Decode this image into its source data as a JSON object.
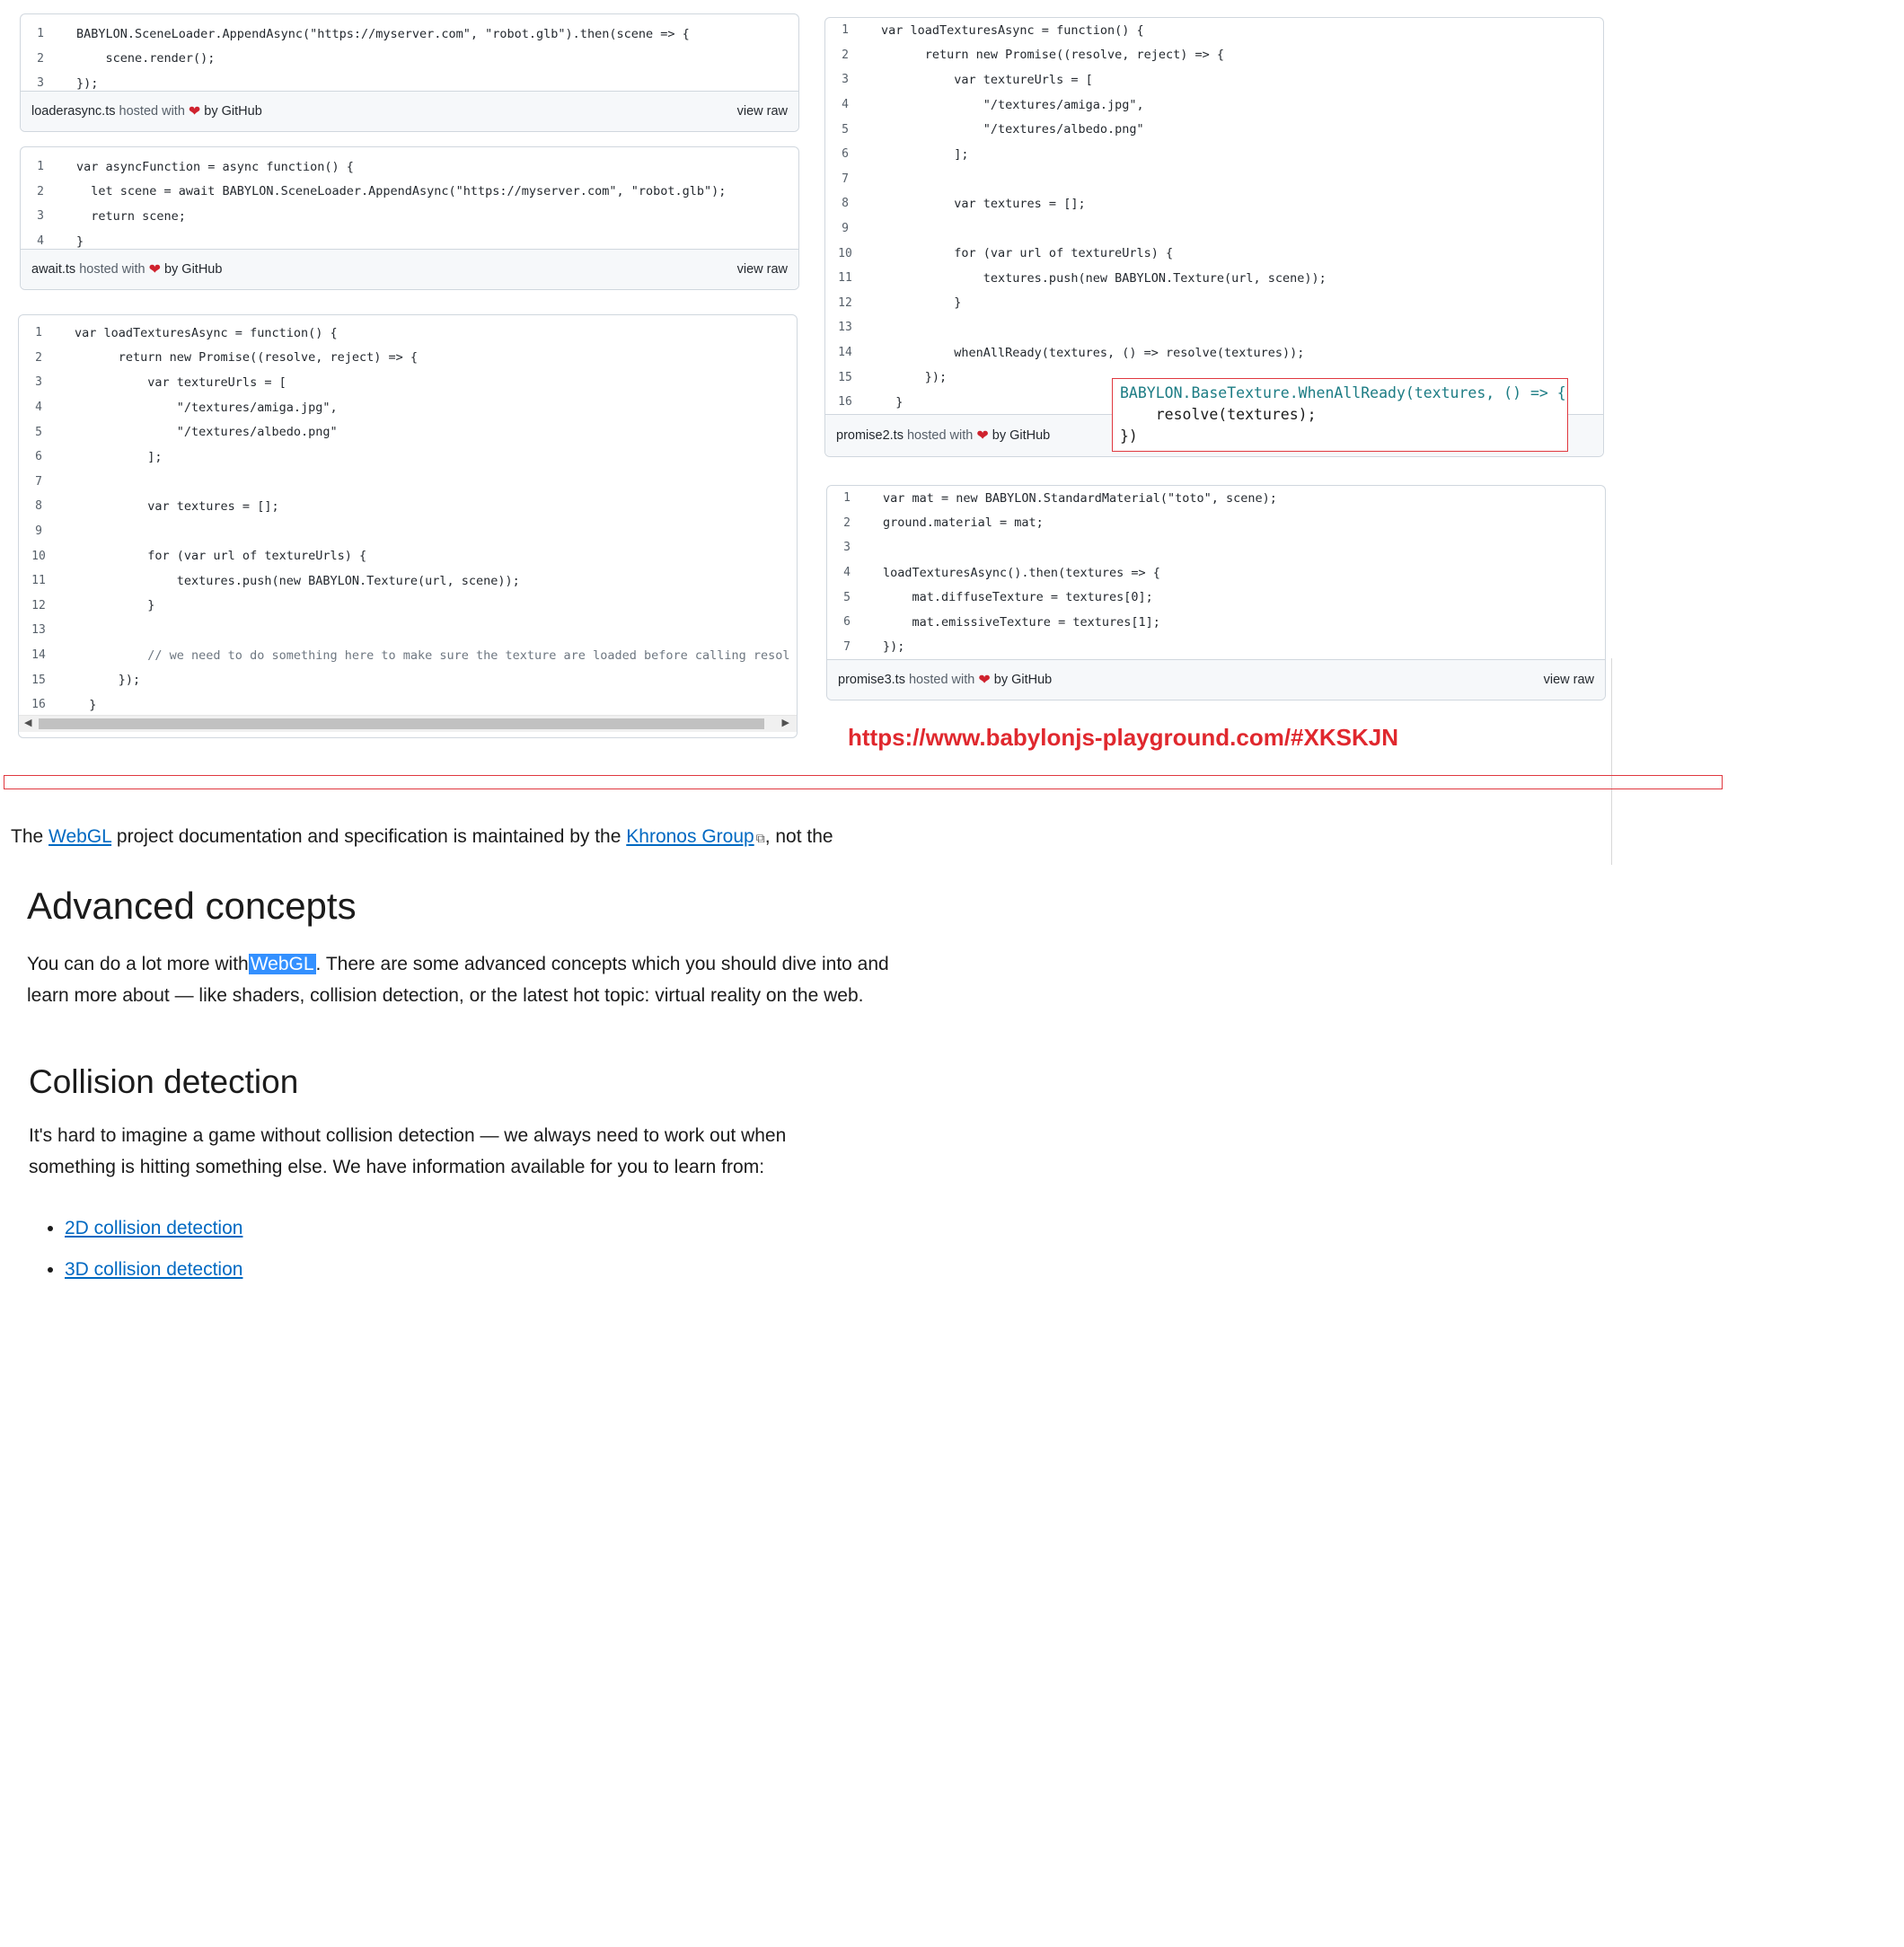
{
  "gist_loaderasync": {
    "lines": [
      {
        "n": "1",
        "t": "BABYLON.SceneLoader.AppendAsync(\"https://myserver.com\", \"robot.glb\").then(scene => {"
      },
      {
        "n": "2",
        "t": "    scene.render();"
      },
      {
        "n": "3",
        "t": "});"
      }
    ],
    "filename": "loaderasync.ts",
    "hosted": "hosted with",
    "by": "by GitHub",
    "raw": "view raw"
  },
  "gist_await": {
    "lines": [
      {
        "n": "1",
        "t": "var asyncFunction = async function() {"
      },
      {
        "n": "2",
        "t": "  let scene = await BABYLON.SceneLoader.AppendAsync(\"https://myserver.com\", \"robot.glb\");"
      },
      {
        "n": "3",
        "t": "  return scene;"
      },
      {
        "n": "4",
        "t": "}"
      }
    ],
    "filename": "await.ts",
    "hosted": "hosted with",
    "by": "by GitHub",
    "raw": "view raw"
  },
  "gist_promise1": {
    "lines": [
      {
        "n": "1",
        "t": "var loadTexturesAsync = function() {"
      },
      {
        "n": "2",
        "t": "      return new Promise((resolve, reject) => {"
      },
      {
        "n": "3",
        "t": "          var textureUrls = ["
      },
      {
        "n": "4",
        "t": "              \"/textures/amiga.jpg\","
      },
      {
        "n": "5",
        "t": "              \"/textures/albedo.png\""
      },
      {
        "n": "6",
        "t": "          ];"
      },
      {
        "n": "7",
        "t": ""
      },
      {
        "n": "8",
        "t": "          var textures = [];"
      },
      {
        "n": "9",
        "t": ""
      },
      {
        "n": "10",
        "t": "          for (var url of textureUrls) {"
      },
      {
        "n": "11",
        "t": "              textures.push(new BABYLON.Texture(url, scene));"
      },
      {
        "n": "12",
        "t": "          }"
      },
      {
        "n": "13",
        "t": ""
      },
      {
        "n": "14",
        "t": "          // we need to do something here to make sure the texture are loaded before calling resol"
      },
      {
        "n": "15",
        "t": "      });"
      },
      {
        "n": "16",
        "t": "  }"
      }
    ]
  },
  "gist_promise2": {
    "lines": [
      {
        "n": "1",
        "t": "var loadTexturesAsync = function() {"
      },
      {
        "n": "2",
        "t": "      return new Promise((resolve, reject) => {"
      },
      {
        "n": "3",
        "t": "          var textureUrls = ["
      },
      {
        "n": "4",
        "t": "              \"/textures/amiga.jpg\","
      },
      {
        "n": "5",
        "t": "              \"/textures/albedo.png\""
      },
      {
        "n": "6",
        "t": "          ];"
      },
      {
        "n": "7",
        "t": ""
      },
      {
        "n": "8",
        "t": "          var textures = [];"
      },
      {
        "n": "9",
        "t": ""
      },
      {
        "n": "10",
        "t": "          for (var url of textureUrls) {"
      },
      {
        "n": "11",
        "t": "              textures.push(new BABYLON.Texture(url, scene));"
      },
      {
        "n": "12",
        "t": "          }"
      },
      {
        "n": "13",
        "t": ""
      },
      {
        "n": "14",
        "t": "          whenAllReady(textures, () => resolve(textures));"
      },
      {
        "n": "15",
        "t": "      });"
      },
      {
        "n": "16",
        "t": "  }"
      }
    ],
    "filename": "promise2.ts",
    "hosted": "hosted with",
    "by": "by GitHub"
  },
  "callout": {
    "line1": "BABYLON.BaseTexture.WhenAllReady(textures, () => {",
    "line2": "    resolve(textures);",
    "line3": "})"
  },
  "gist_promise3": {
    "lines": [
      {
        "n": "1",
        "t": "var mat = new BABYLON.StandardMaterial(\"toto\", scene);"
      },
      {
        "n": "2",
        "t": "ground.material = mat;"
      },
      {
        "n": "3",
        "t": ""
      },
      {
        "n": "4",
        "t": "loadTexturesAsync().then(textures => {"
      },
      {
        "n": "5",
        "t": "    mat.diffuseTexture = textures[0];"
      },
      {
        "n": "6",
        "t": "    mat.emissiveTexture = textures[1];"
      },
      {
        "n": "7",
        "t": "});"
      }
    ],
    "filename": "promise3.ts",
    "hosted": "hosted with",
    "by": "by GitHub",
    "raw": "view raw"
  },
  "playground_url": "https://www.babylonjs-playground.com/#XKSKJN",
  "doc": {
    "intro_pre": "The ",
    "intro_link1": "WebGL",
    "intro_mid": " project documentation and specification is maintained by the ",
    "intro_link2": "Khronos Group",
    "intro_post": ", not the",
    "h_advanced": "Advanced concepts",
    "adv_pre": "You can do a lot more with",
    "adv_hl": "WebGL",
    "adv_post": ". There are some advanced concepts which you should dive into and learn more about — like shaders, collision detection, or the latest hot topic: virtual reality on the web.",
    "h_collision": "Collision detection",
    "col_text": "It's hard to imagine a game without collision detection — we always need to work out when something is hitting something else. We have information available for you to learn from:",
    "links": [
      "2D collision detection",
      "3D collision detection"
    ]
  },
  "colors": {
    "link": "#0069c2",
    "highlight": "#3390ff",
    "annotation_red": "#e0282e"
  }
}
